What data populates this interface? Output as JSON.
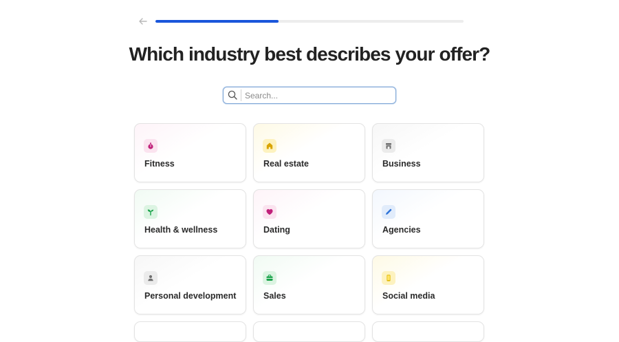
{
  "header": {
    "back_icon": "arrow-left-icon",
    "progress": 0.4
  },
  "title": "Which industry best describes your offer?",
  "search": {
    "icon": "search-icon",
    "placeholder": "Search...",
    "value": ""
  },
  "industries": [
    {
      "label": "Fitness",
      "icon": "stopwatch-icon",
      "icon_color": "#c0217a",
      "tint": "#fbe3ef"
    },
    {
      "label": "Real estate",
      "icon": "house-icon",
      "icon_color": "#d9a400",
      "tint": "#fdf2bf"
    },
    {
      "label": "Business",
      "icon": "store-icon",
      "icon_color": "#707070",
      "tint": "#ebebeb"
    },
    {
      "label": "Health & wellness",
      "icon": "sprout-icon",
      "icon_color": "#1aa34a",
      "tint": "#dcf4e2"
    },
    {
      "label": "Dating",
      "icon": "heart-icon",
      "icon_color": "#c0217a",
      "tint": "#fbe3ef"
    },
    {
      "label": "Agencies",
      "icon": "pencil-icon",
      "icon_color": "#2f74d8",
      "tint": "#e1ecfb"
    },
    {
      "label": "Personal development",
      "icon": "person-icon",
      "icon_color": "#707070",
      "tint": "#ebebeb"
    },
    {
      "label": "Sales",
      "icon": "briefcase-icon",
      "icon_color": "#1aa34a",
      "tint": "#dcf4e2"
    },
    {
      "label": "Social media",
      "icon": "phone-icon",
      "icon_color": "#e0b800",
      "tint": "#fdf2bf"
    }
  ],
  "colors": {
    "accent": "#1a56db",
    "track": "#ededed"
  }
}
